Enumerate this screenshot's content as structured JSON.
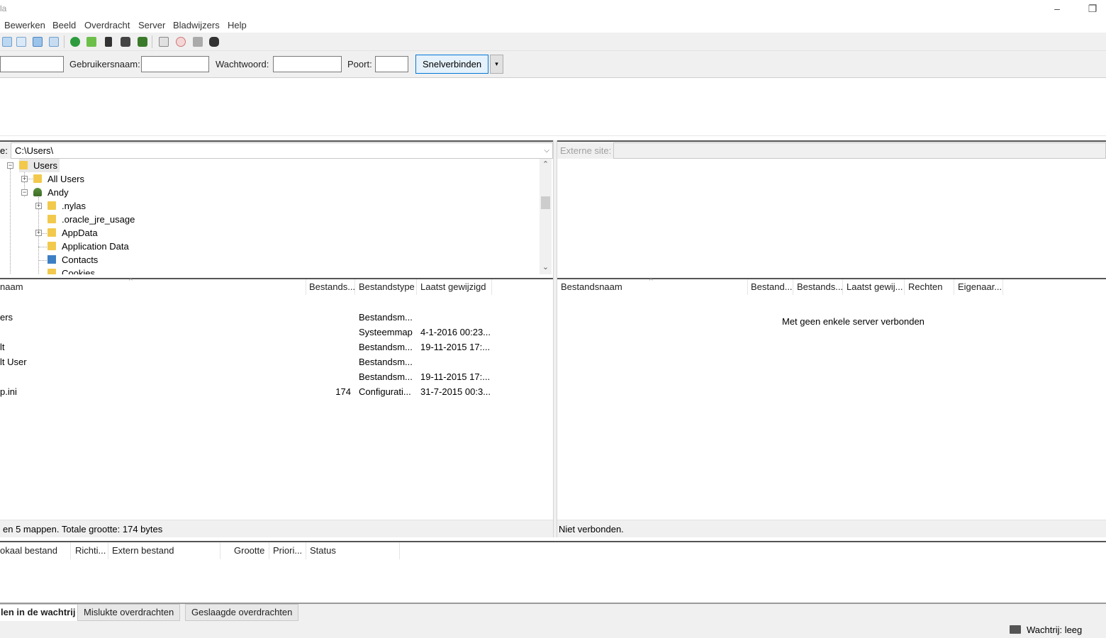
{
  "window": {
    "title_fragment": "la"
  },
  "menu": [
    "Bewerken",
    "Beeld",
    "Overdracht",
    "Server",
    "Bladwijzers",
    "Help"
  ],
  "toolbar": {
    "icons": [
      "site-manager-icon",
      "toggle-log-icon",
      "toggle-local-tree-icon",
      "toggle-remote-tree-icon",
      "refresh-icon",
      "process-queue-icon",
      "cancel-icon",
      "disconnect-icon",
      "reconnect-icon",
      "directory-compare-icon",
      "filter-icon",
      "sync-browse-icon",
      "search-icon"
    ]
  },
  "quickconnect": {
    "username_label": "Gebruikersnaam:",
    "password_label": "Wachtwoord:",
    "port_label": "Poort:",
    "connect_label": "Snelverbinden",
    "dropdown_glyph": "▾"
  },
  "local": {
    "path_label": "e:",
    "path_value": "C:\\Users\\",
    "tree": [
      {
        "label": "Users",
        "icon": "folder-icon"
      },
      {
        "label": "All Users",
        "icon": "folder-icon"
      },
      {
        "label": "Andy",
        "icon": "user-folder-icon"
      },
      {
        "label": ".nylas",
        "icon": "folder-icon"
      },
      {
        "label": ".oracle_jre_usage",
        "icon": "folder-icon"
      },
      {
        "label": "AppData",
        "icon": "folder-icon"
      },
      {
        "label": "Application Data",
        "icon": "folder-icon"
      },
      {
        "label": "Contacts",
        "icon": "contacts-folder-icon"
      },
      {
        "label": "Cookies",
        "icon": "folder-icon"
      }
    ],
    "columns": [
      "naam",
      "Bestands...",
      "Bestandstype",
      "Laatst gewijzigd"
    ],
    "rows": [
      {
        "name": "",
        "size": "",
        "type": "",
        "modified": ""
      },
      {
        "name": "ers",
        "size": "",
        "type": "Bestandsm...",
        "modified": ""
      },
      {
        "name": "",
        "size": "",
        "type": "Systeemmap",
        "modified": "4-1-2016 00:23..."
      },
      {
        "name": "lt",
        "size": "",
        "type": "Bestandsm...",
        "modified": "19-11-2015 17:..."
      },
      {
        "name": "lt User",
        "size": "",
        "type": "Bestandsm...",
        "modified": ""
      },
      {
        "name": "",
        "size": "",
        "type": "Bestandsm...",
        "modified": "19-11-2015 17:..."
      },
      {
        "name": "p.ini",
        "size": "174",
        "type": "Configurati...",
        "modified": "31-7-2015 00:3..."
      }
    ],
    "status": " en 5 mappen. Totale grootte: 174 bytes"
  },
  "remote": {
    "path_label": "Externe site:",
    "columns": [
      "Bestandsnaam",
      "Bestand...",
      "Bestands...",
      "Laatst gewij...",
      "Rechten",
      "Eigenaar..."
    ],
    "empty_message": "Met geen enkele server verbonden",
    "status": "Niet verbonden."
  },
  "queue": {
    "columns": [
      "okaal bestand",
      "Richti...",
      "Extern bestand",
      "Grootte",
      "Priori...",
      "Status"
    ],
    "tabs": [
      "len in de wachtrij",
      "Mislukte overdrachten",
      "Geslaagde overdrachten"
    ]
  },
  "statusbar": {
    "queue_label": "Wachtrij: leeg"
  },
  "colors": {
    "accent": "#0078d7",
    "folder": "#f2c94c"
  }
}
